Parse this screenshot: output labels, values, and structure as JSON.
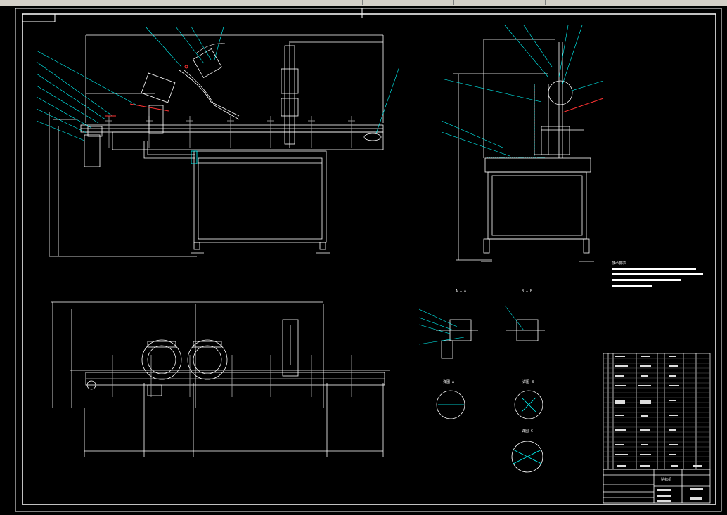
{
  "window": {
    "toolbar_segments": [
      "",
      "",
      "",
      "",
      "",
      ""
    ]
  },
  "drawing": {
    "view_labels": {
      "section_aa": "A — A",
      "section_bb": "B — B",
      "detail_1": "详图 A",
      "detail_2": "详图 B",
      "detail_3": "详图 C",
      "scale": "2:1"
    },
    "tech_requirements_title": "技术要求",
    "title_block_name": "贴标机",
    "title_block_number": ""
  },
  "colors": {
    "line": "#ffffff",
    "leader": "#00ffff",
    "highlight": "#ff3030",
    "gray": "#9a9a9a"
  }
}
